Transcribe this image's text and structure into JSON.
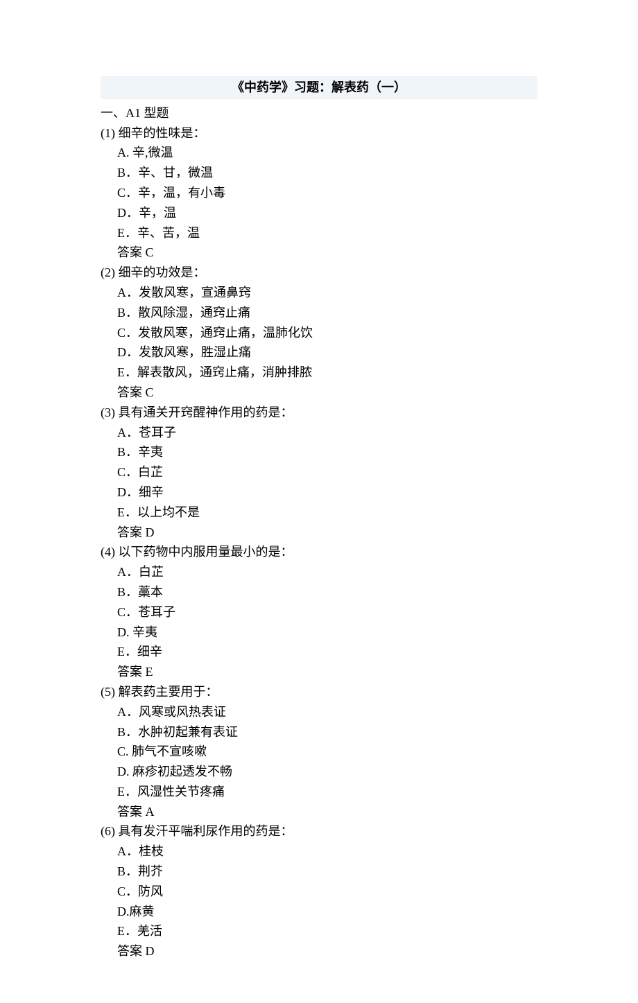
{
  "title": "《中药学》习题：解表药（一）",
  "section_heading": "一、A1 型题",
  "questions": [
    {
      "num": "(1)",
      "stem": "细辛的性味是：",
      "options": [
        "A. 辛,微温",
        "B．辛、甘，微温",
        "C．辛，温，有小毒",
        "D．辛，温",
        "E．辛、苦，温"
      ],
      "answer": "答案 C"
    },
    {
      "num": "(2)",
      "stem": "细辛的功效是：",
      "options": [
        "A．发散风寒，宣通鼻窍",
        "B．散风除湿，通窍止痛",
        "C．发散风寒，通窍止痛，温肺化饮",
        "D．发散风寒，胜湿止痛",
        "E．解表散风，通窍止痛，消肿排脓"
      ],
      "answer": "答案 C"
    },
    {
      "num": "(3)",
      "stem": "具有通关开窍醒神作用的药是：",
      "options": [
        "A．苍耳子",
        "B．辛夷",
        "C．白芷",
        "D．细辛",
        "E．以上均不是"
      ],
      "answer": "答案 D"
    },
    {
      "num": "(4)",
      "stem": "以下药物中内服用量最小的是：",
      "options": [
        "A．白芷",
        "B．藁本",
        "C．苍耳子",
        "D. 辛夷",
        "E．细辛"
      ],
      "answer": "答案 E"
    },
    {
      "num": "(5)",
      "stem": "解表药主要用于：",
      "options": [
        "A．风寒或风热表证",
        "B．水肿初起兼有表证",
        "C. 肺气不宣咳嗽",
        "D. 麻疹初起透发不畅",
        "E．风湿性关节疼痛"
      ],
      "answer": "答案 A"
    },
    {
      "num": "(6)",
      "stem": "具有发汗平喘利尿作用的药是：",
      "options": [
        "A．桂枝",
        "B．荆芥",
        "C．防风",
        "D.麻黄",
        "E．羌活"
      ],
      "answer": "答案 D"
    }
  ]
}
